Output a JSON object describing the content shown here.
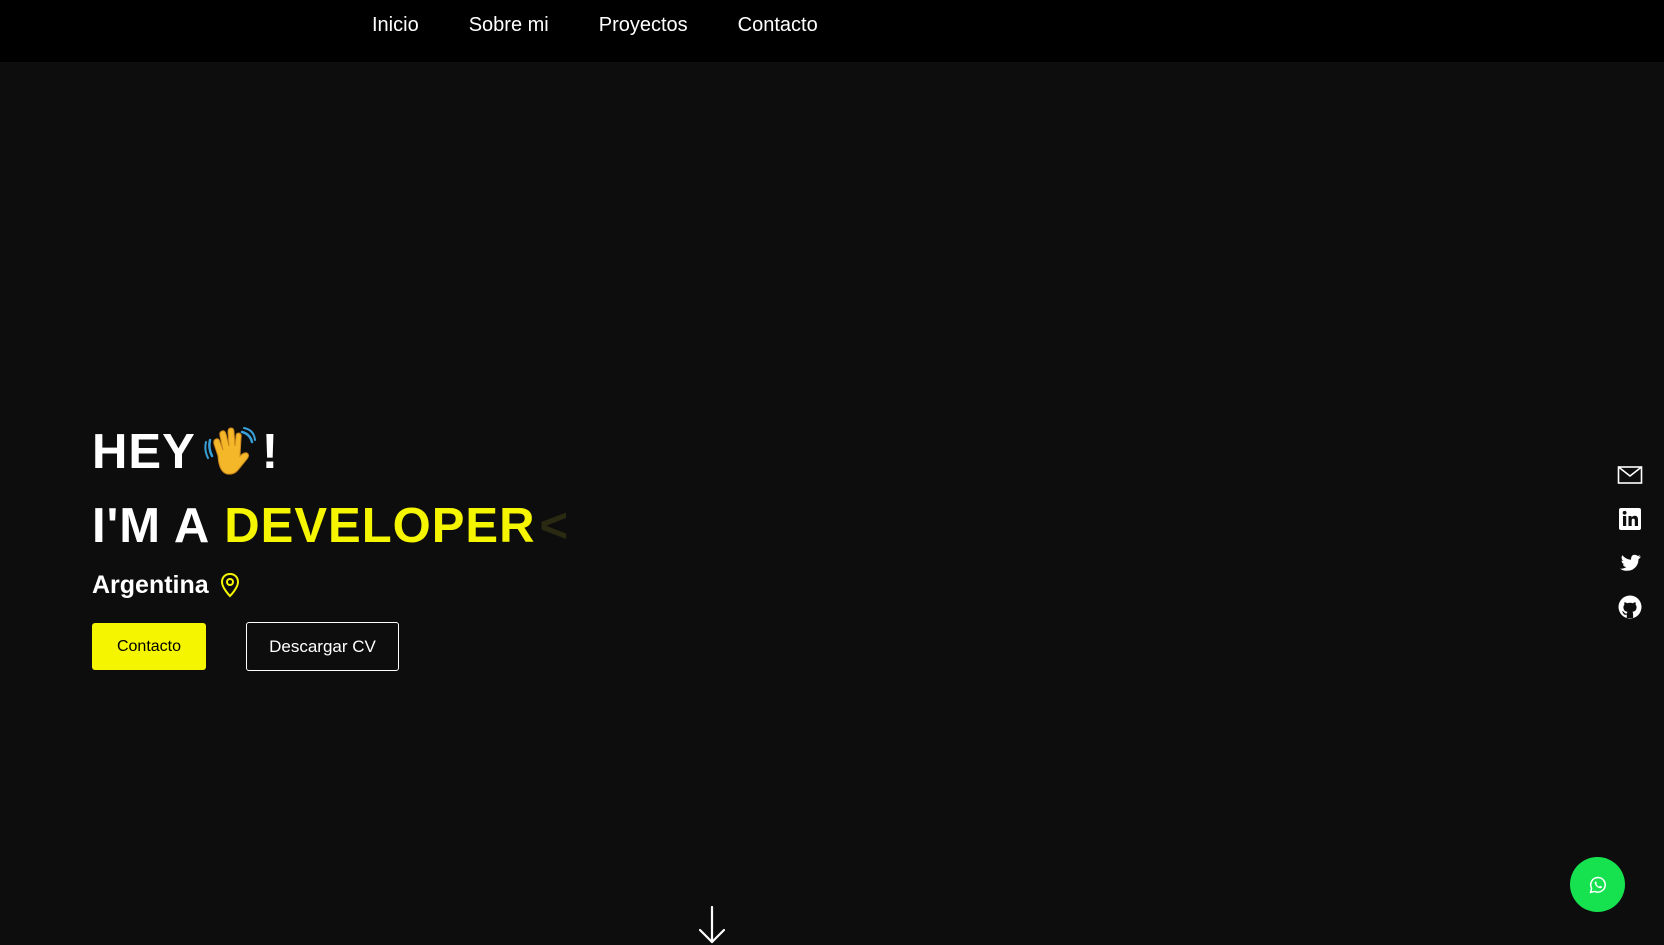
{
  "nav": {
    "items": [
      {
        "label": "Inicio"
      },
      {
        "label": "Sobre mi"
      },
      {
        "label": "Proyectos"
      },
      {
        "label": "Contacto"
      }
    ]
  },
  "hero": {
    "greeting": "HEY",
    "greeting_suffix": "!",
    "wave_icon": "waving-hand-icon",
    "line2_prefix": "I'M A",
    "line2_role": "DEVELOPER",
    "caret": "<",
    "location": "Argentina",
    "location_icon": "map-pin-icon"
  },
  "buttons": {
    "contact_label": "Contacto",
    "cv_label": "Descargar CV"
  },
  "social": {
    "icons": [
      "mail-icon",
      "linkedin-icon",
      "twitter-icon",
      "github-icon"
    ]
  },
  "floating": {
    "whatsapp_icon": "whatsapp-icon",
    "scroll_icon": "arrow-down-icon"
  },
  "colors": {
    "background": "#0d0d0d",
    "navbar": "#000000",
    "accent": "#f5f500",
    "whatsapp": "#16e24f",
    "text": "#ffffff"
  }
}
